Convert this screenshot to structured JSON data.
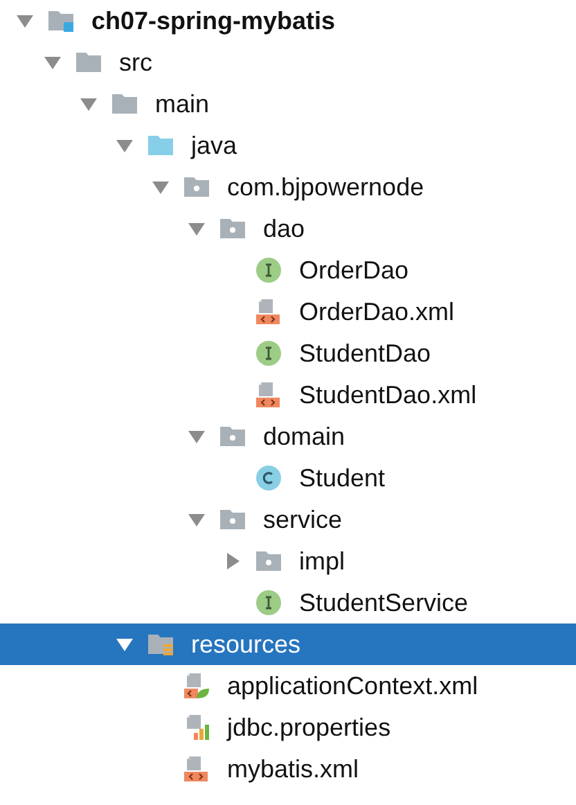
{
  "project_tree": {
    "items": [
      {
        "label": "ch07-spring-mybatis",
        "kind": "module",
        "expanded": true,
        "selected": false,
        "children": [
          {
            "label": "src",
            "kind": "folder",
            "expanded": true,
            "selected": false,
            "children": [
              {
                "label": "main",
                "kind": "folder",
                "expanded": true,
                "selected": false,
                "children": [
                  {
                    "label": "java",
                    "kind": "source",
                    "expanded": true,
                    "selected": false,
                    "children": [
                      {
                        "label": "com.bjpowernode",
                        "kind": "package",
                        "expanded": true,
                        "selected": false,
                        "children": [
                          {
                            "label": "dao",
                            "kind": "package",
                            "expanded": true,
                            "selected": false,
                            "children": [
                              {
                                "label": "OrderDao",
                                "kind": "interface",
                                "selected": false
                              },
                              {
                                "label": "OrderDao.xml",
                                "kind": "xml",
                                "selected": false
                              },
                              {
                                "label": "StudentDao",
                                "kind": "interface",
                                "selected": false
                              },
                              {
                                "label": "StudentDao.xml",
                                "kind": "xml",
                                "selected": false
                              }
                            ]
                          },
                          {
                            "label": "domain",
                            "kind": "package",
                            "expanded": true,
                            "selected": false,
                            "children": [
                              {
                                "label": "Student",
                                "kind": "class",
                                "selected": false
                              }
                            ]
                          },
                          {
                            "label": "service",
                            "kind": "package",
                            "expanded": true,
                            "selected": false,
                            "children": [
                              {
                                "label": "impl",
                                "kind": "package",
                                "expanded": false,
                                "selected": false
                              },
                              {
                                "label": "StudentService",
                                "kind": "interface",
                                "selected": false
                              }
                            ]
                          }
                        ]
                      }
                    ]
                  },
                  {
                    "label": "resources",
                    "kind": "resources",
                    "expanded": true,
                    "selected": true,
                    "children": [
                      {
                        "label": "applicationContext.xml",
                        "kind": "spring-xml",
                        "selected": false
                      },
                      {
                        "label": "jdbc.properties",
                        "kind": "properties",
                        "selected": false
                      },
                      {
                        "label": "mybatis.xml",
                        "kind": "xml",
                        "selected": false
                      }
                    ]
                  }
                ]
              }
            ]
          }
        ]
      }
    ]
  }
}
